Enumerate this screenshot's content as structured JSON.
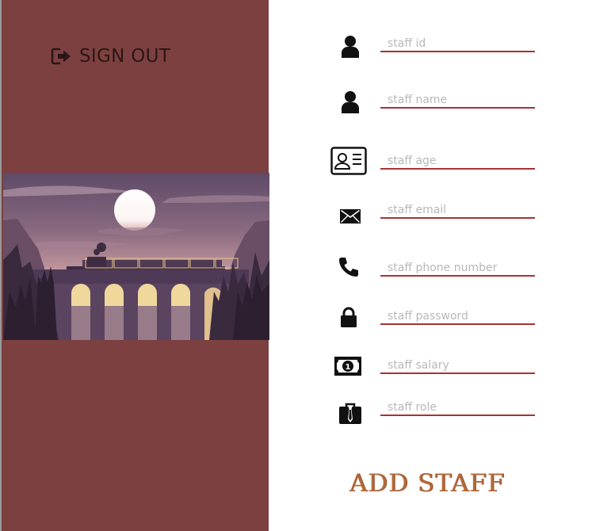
{
  "sidebar": {
    "sign_out_label": "SIGN OUT",
    "sign_out_icon": "sign-out-icon",
    "background": "#7d4040"
  },
  "illustration": {
    "subject": "train crossing a viaduct at sunset",
    "palette": [
      "#6b5370",
      "#a98593",
      "#e8c48c",
      "#3e2d42"
    ]
  },
  "form": {
    "fields": [
      {
        "icon": "user-icon",
        "placeholder": "staff id"
      },
      {
        "icon": "user-icon",
        "placeholder": "staff name"
      },
      {
        "icon": "id-card-icon",
        "placeholder": "staff age"
      },
      {
        "icon": "envelope-icon",
        "placeholder": "staff email"
      },
      {
        "icon": "phone-icon",
        "placeholder": "staff phone number"
      },
      {
        "icon": "lock-icon",
        "placeholder": "staff password"
      },
      {
        "icon": "money-icon",
        "placeholder": "staff salary"
      },
      {
        "icon": "briefcase-icon",
        "placeholder": "staff role"
      }
    ],
    "submit_label": "ADD STAFF",
    "underline_color": "#a83232",
    "submit_color": "#b56a3a"
  }
}
